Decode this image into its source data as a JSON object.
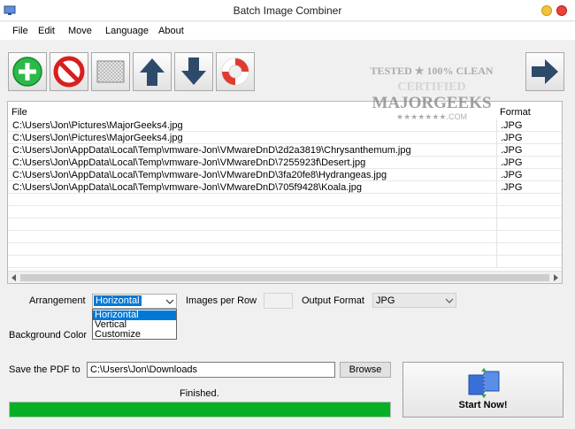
{
  "window": {
    "title": "Batch Image Combiner"
  },
  "menu": [
    "File",
    "Edit",
    "Move",
    "Language",
    "About"
  ],
  "toolbar_icons": [
    "add-icon",
    "remove-icon",
    "clear-list-icon",
    "move-up-icon",
    "move-down-icon",
    "help-icon",
    "next-arrow-icon"
  ],
  "watermark": {
    "line1": "TESTED ★ 100% CLEAN",
    "line2": "CERTIFIED",
    "line3": "MAJORGEEKS",
    "line4": "★★★★★★★.COM"
  },
  "list": {
    "headers": {
      "file": "File",
      "format": "Format"
    },
    "rows": [
      {
        "file": "C:\\Users\\Jon\\Pictures\\MajorGeeks4.jpg",
        "format": ".JPG"
      },
      {
        "file": "C:\\Users\\Jon\\Pictures\\MajorGeeks4.jpg",
        "format": ".JPG"
      },
      {
        "file": "C:\\Users\\Jon\\AppData\\Local\\Temp\\vmware-Jon\\VMwareDnD\\2d2a3819\\Chrysanthemum.jpg",
        "format": ".JPG"
      },
      {
        "file": "C:\\Users\\Jon\\AppData\\Local\\Temp\\vmware-Jon\\VMwareDnD\\7255923f\\Desert.jpg",
        "format": ".JPG"
      },
      {
        "file": "C:\\Users\\Jon\\AppData\\Local\\Temp\\vmware-Jon\\VMwareDnD\\3fa20fe8\\Hydrangeas.jpg",
        "format": ".JPG"
      },
      {
        "file": "C:\\Users\\Jon\\AppData\\Local\\Temp\\vmware-Jon\\VMwareDnD\\705f9428\\Koala.jpg",
        "format": ".JPG"
      }
    ]
  },
  "options": {
    "arrangement_label": "Arrangement",
    "arrangement_value": "Horizontal",
    "arrangement_options": [
      "Horizontal",
      "Vertical",
      "Customize"
    ],
    "images_per_row_label": "Images per Row",
    "images_per_row_value": "",
    "output_format_label": "Output Format",
    "output_format_value": "JPG",
    "background_color_label": "Background Color"
  },
  "save": {
    "label": "Save the PDF to",
    "path": "C:\\Users\\Jon\\Downloads",
    "browse_label": "Browse"
  },
  "status": {
    "text": "Finished.",
    "progress_percent": 100
  },
  "start": {
    "label": "Start Now!"
  },
  "colors": {
    "progress": "#06b025",
    "selection": "#0078d7",
    "add": "#2db84a",
    "remove": "#d81e1e",
    "arrow": "#2e4a6b"
  }
}
